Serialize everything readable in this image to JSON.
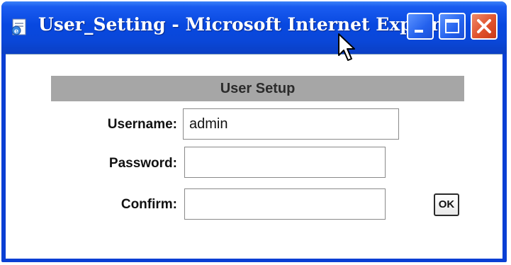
{
  "window": {
    "title": "User_Setting - Microsoft Internet Explorer",
    "icons": [
      "ie-page-icon",
      "minimize-icon",
      "maximize-icon",
      "close-icon"
    ]
  },
  "form": {
    "section_title": "User Setup",
    "username": {
      "label": "Username:",
      "value": "admin"
    },
    "password": {
      "label": "Password:",
      "value": ""
    },
    "confirm": {
      "label": "Confirm:",
      "value": ""
    },
    "ok_label": "OK"
  },
  "colors": {
    "titlebar": "#0a47d8",
    "close_button": "#e0522c",
    "section_header_bg": "#a6a6a6"
  }
}
